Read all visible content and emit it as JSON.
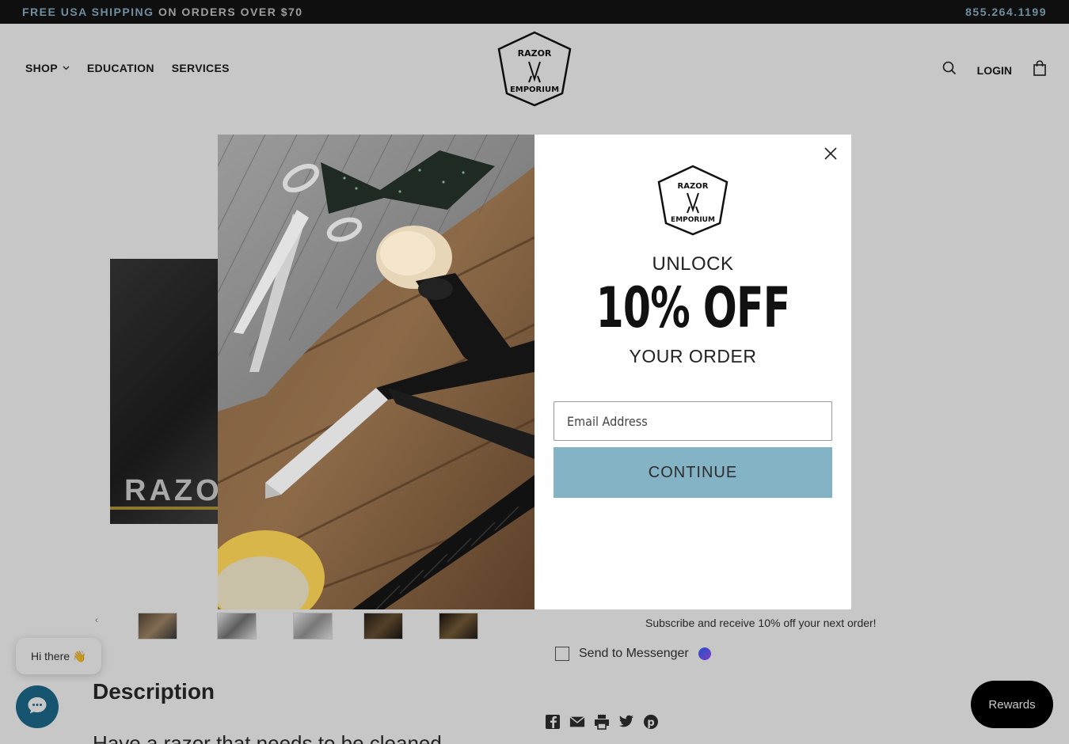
{
  "topbar": {
    "promo_highlight": "FREE USA SHIPPING",
    "promo_rest": " ON ORDERS OVER $70",
    "phone": "855.264.1199"
  },
  "header": {
    "nav": [
      {
        "label": "SHOP"
      },
      {
        "label": "EDUCATION"
      },
      {
        "label": "SERVICES"
      }
    ],
    "login": "LOGIN"
  },
  "page": {
    "hero_word": "RAZO",
    "description_title": "Description",
    "description_text": "Have a razor that needs to be cleaned",
    "subscribe_text": "Subscribe and receive 10% off your next order!",
    "messenger_label": "Send to Messenger"
  },
  "chat": {
    "greeting": "Hi there 👋"
  },
  "rewards": {
    "label": "Rewards"
  },
  "modal": {
    "unlock": "UNLOCK",
    "offer": "10% OFF",
    "your_order": "YOUR ORDER",
    "email_placeholder": "Email Address",
    "continue_label": "CONTINUE"
  },
  "colors": {
    "accent_blue": "#85b3c6",
    "topbar_bg": "#141414",
    "rewards_bg": "#000000",
    "chat_bg": "#1d6c8f"
  },
  "icons": [
    "search-icon",
    "bag-icon",
    "close-icon",
    "chevron-down-icon",
    "facebook-icon",
    "email-icon",
    "print-icon",
    "twitter-icon",
    "pinterest-icon",
    "messenger-icon",
    "chat-icon"
  ]
}
